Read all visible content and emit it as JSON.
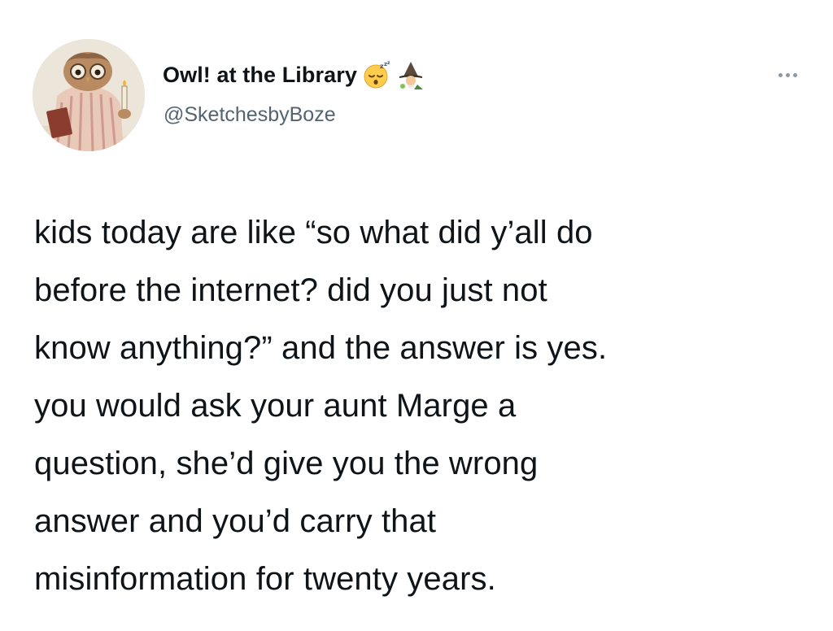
{
  "tweet": {
    "author": {
      "display_name": "Owl! at the Library",
      "handle": "@SketchesbyBoze",
      "avatar_icon": "owl-avatar",
      "badges": [
        "sleeping-face-emoji",
        "mage-emoji"
      ]
    },
    "more_icon": "more-dots-icon",
    "text_lines": [
      "kids today are like “so what did y’all do",
      "before the internet? did you just not",
      "know anything?” and the answer is yes.",
      "you would ask your aunt Marge a",
      "question, she’d give you the wrong",
      "answer and you’d carry that",
      "misinformation for twenty years."
    ]
  }
}
